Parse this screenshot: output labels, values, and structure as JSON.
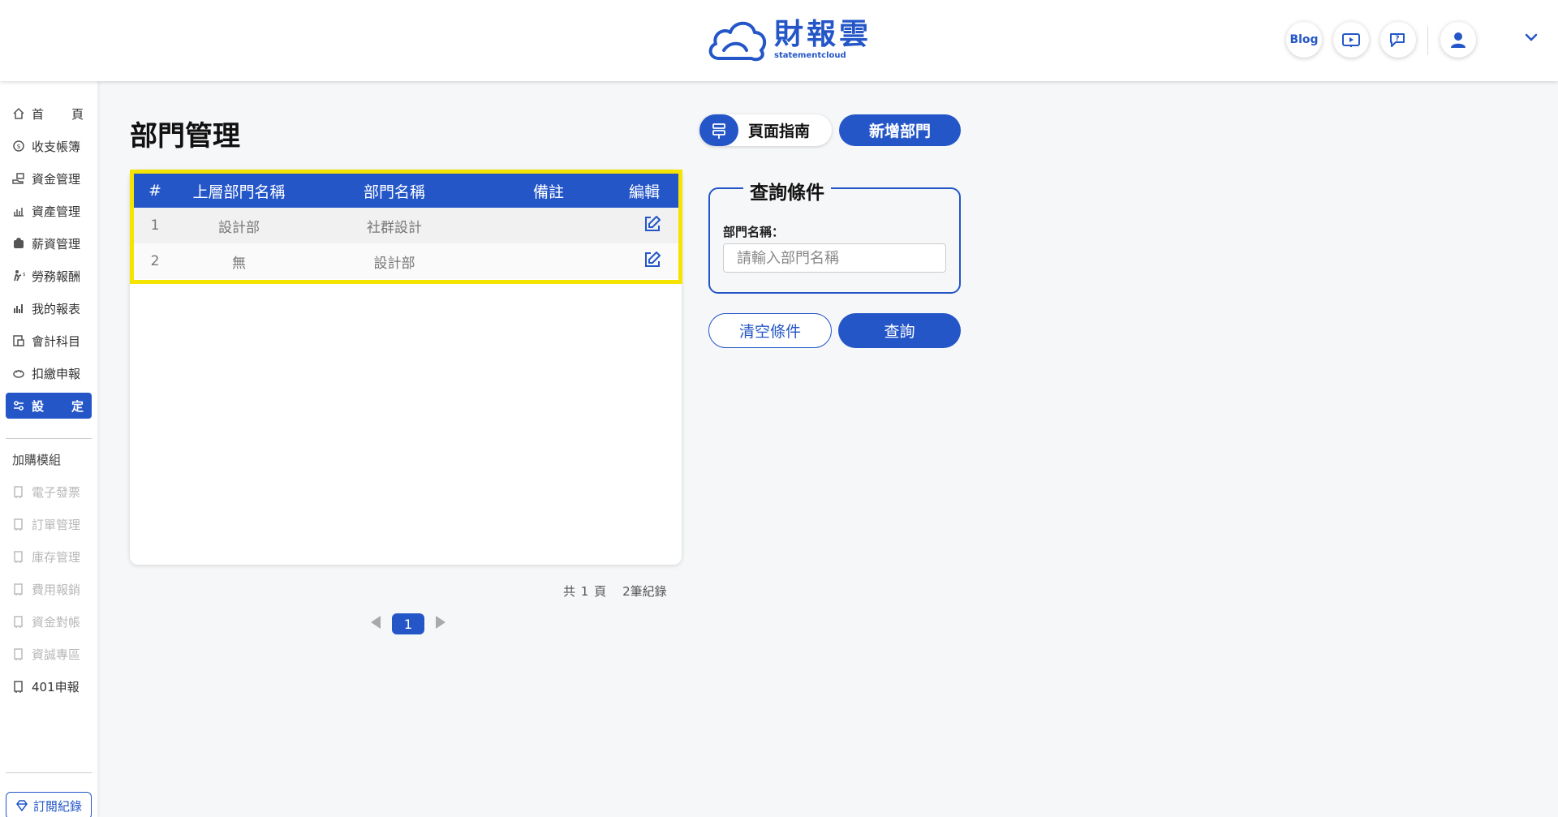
{
  "brand": {
    "name": "財報雲",
    "sub": "statementcloud",
    "accent": "#2456c8"
  },
  "header": {
    "blog_label": "Blog"
  },
  "sidebar": {
    "items": [
      {
        "label": "首頁",
        "icon": "home-icon"
      },
      {
        "label": "收支帳簿",
        "icon": "coin-icon"
      },
      {
        "label": "資金管理",
        "icon": "cash-hand-icon"
      },
      {
        "label": "資產管理",
        "icon": "chart-building-icon"
      },
      {
        "label": "薪資管理",
        "icon": "wallet-icon"
      },
      {
        "label": "勞務報酬",
        "icon": "worker-icon"
      },
      {
        "label": "我的報表",
        "icon": "bar-chart-icon"
      },
      {
        "label": "會計科目",
        "icon": "ledger-icon"
      },
      {
        "label": "扣繳申報",
        "icon": "piggy-icon"
      },
      {
        "label": "設定",
        "icon": "sliders-icon"
      }
    ],
    "addon_heading": "加購模組",
    "addons": [
      {
        "label": "電子發票",
        "disabled": true
      },
      {
        "label": "訂單管理",
        "disabled": true
      },
      {
        "label": "庫存管理",
        "disabled": true
      },
      {
        "label": "費用報銷",
        "disabled": true
      },
      {
        "label": "資金對帳",
        "disabled": true
      },
      {
        "label": "資誠專區",
        "disabled": true
      },
      {
        "label": "401申報",
        "disabled": false
      }
    ],
    "subscription_label": "訂閱紀錄"
  },
  "main": {
    "title": "部門管理",
    "table": {
      "headers": [
        "#",
        "上層部門名稱",
        "部門名稱",
        "備註",
        "編輯"
      ],
      "rows": [
        {
          "num": "1",
          "parent": "設計部",
          "name": "社群設計",
          "note": ""
        },
        {
          "num": "2",
          "parent": "無",
          "name": "設計部",
          "note": ""
        }
      ]
    },
    "pagination": {
      "pages_text": "共 1 頁",
      "records_text": "2筆紀錄",
      "current": "1"
    }
  },
  "panel": {
    "guide_label": "頁面指南",
    "add_label": "新增部門",
    "query_title": "查詢條件",
    "field_label": "部門名稱：",
    "field_placeholder": "請輸入部門名稱",
    "field_value": "",
    "clear_label": "清空條件",
    "search_label": "查詢"
  }
}
